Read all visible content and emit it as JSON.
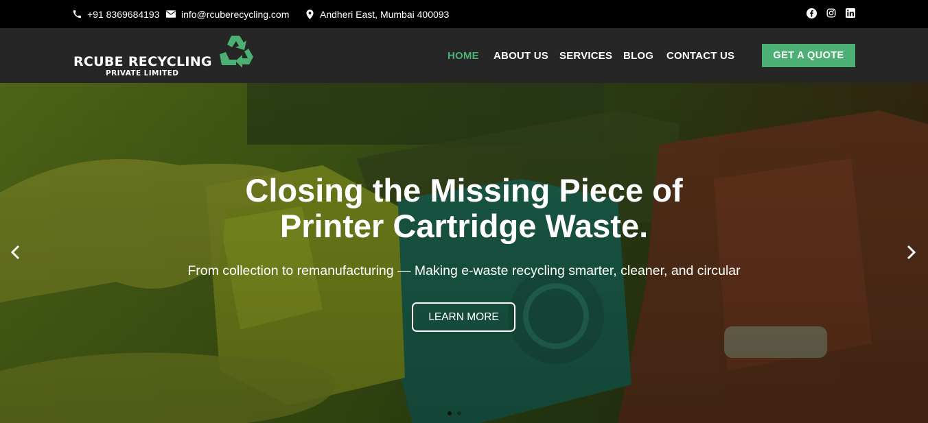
{
  "topbar": {
    "phone": "+91 8369684193",
    "email": "info@rcuberecycling.com",
    "address": "Andheri East, Mumbai 400093",
    "icons": {
      "phone": "phone-icon",
      "email": "envelope-icon",
      "address": "map-pin-icon"
    },
    "social": [
      "facebook-icon",
      "instagram-icon",
      "linkedin-icon"
    ]
  },
  "header": {
    "logo_main": "RCUBE RECYCLING",
    "logo_sub": "PRIVATE LIMITED",
    "nav": [
      {
        "label": "HOME",
        "active": true
      },
      {
        "label": "ABOUT US",
        "active": false
      },
      {
        "label": "SERVICES",
        "active": false
      },
      {
        "label": "BLOG",
        "active": false
      },
      {
        "label": "CONTACT US",
        "active": false
      }
    ],
    "cta_label": "GET A QUOTE"
  },
  "hero": {
    "title_line1": "Closing the Missing Piece of",
    "title_line2": "Printer Cartridge Waste.",
    "subtitle": "From collection to remanufacturing — Making e-waste recycling smarter, cleaner, and circular",
    "button_label": "LEARN MORE",
    "slide_count": 2,
    "active_slide": 1
  },
  "colors": {
    "accent": "#4caf73",
    "topbar_bg": "#000000",
    "header_bg": "#262626"
  }
}
